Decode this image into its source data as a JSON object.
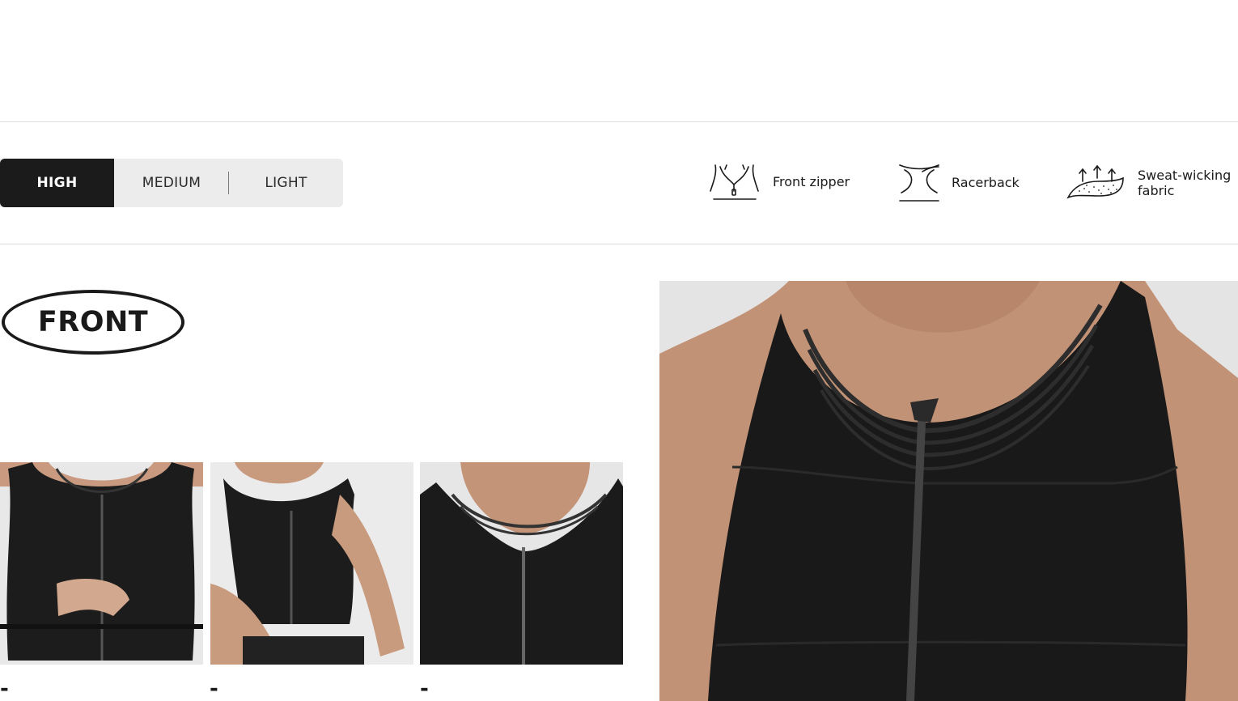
{
  "support_levels": {
    "items": [
      {
        "label": "HIGH",
        "active": true
      },
      {
        "label": "MEDIUM",
        "active": false
      },
      {
        "label": "LIGHT",
        "active": false
      }
    ]
  },
  "features": [
    {
      "icon": "front-zipper-icon",
      "label": "Front zipper"
    },
    {
      "icon": "racerback-icon",
      "label": "Racerback"
    },
    {
      "icon": "sweat-wicking-icon",
      "label": "Sweat-wicking fabric"
    }
  ],
  "view_badge": "FRONT",
  "thumbnails": [
    {
      "dash": "-"
    },
    {
      "dash": "-"
    },
    {
      "dash": "-"
    }
  ],
  "colors": {
    "accent": "#1b1b1b",
    "toggle_bg": "#ececec",
    "divider": "#dcdcdc"
  }
}
